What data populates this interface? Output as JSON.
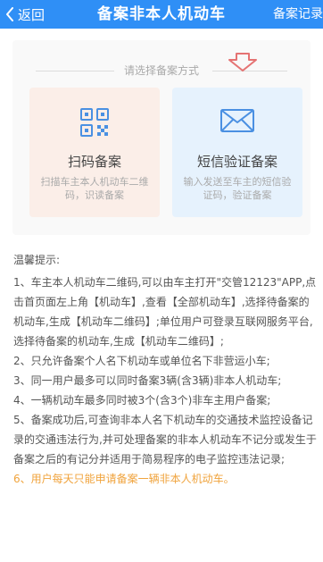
{
  "nav": {
    "back_label": "返回",
    "title": "备案非本人机动车",
    "right_label": "备案记录"
  },
  "method": {
    "header": "请选择备案方式",
    "options": [
      {
        "title": "扫码备案",
        "desc": "扫描车主本人机动车二维码，识读备案",
        "icon": "qr-code-icon"
      },
      {
        "title": "短信验证备案",
        "desc": "输入发送至车主的短信验证码，验证备案",
        "icon": "envelope-icon"
      }
    ]
  },
  "tips": {
    "title": "温馨提示:",
    "items": [
      "1、车主本人机动车二维码,可以由车主打开\"交管12123\"APP,点击首页面左上角【机动车】,查看【全部机动车】,选择待备案的机动车,生成【机动车二维码】;单位用户可登录互联网服务平台,选择待备案的机动车,生成【机动车二维码】;",
      "2、只允许备案个人名下机动车或单位名下非营运小车;",
      "3、同一用户最多可以同时备案3辆(含3辆)非本人机动车;",
      "4、一辆机动车最多同时被3个(含3个)非车主用户备案;",
      "5、备案成功后,可查询非本人名下机动车的交通技术监控设备记录的交通违法行为,并可处理备案的非本人机动车不记分或发生于备案之后的有记分并适用于简易程序的电子监控违法记录;",
      "6、用户每天只能申请备案一辆非本人机动车。"
    ]
  },
  "colors": {
    "nav_bg": "#2f8ff6",
    "qr_card_bg": "#fbeee8",
    "sms_card_bg": "#e6f2fd",
    "icon_blue": "#4a90e2",
    "arrow_red": "#e57373",
    "warn": "#f0a33c"
  }
}
